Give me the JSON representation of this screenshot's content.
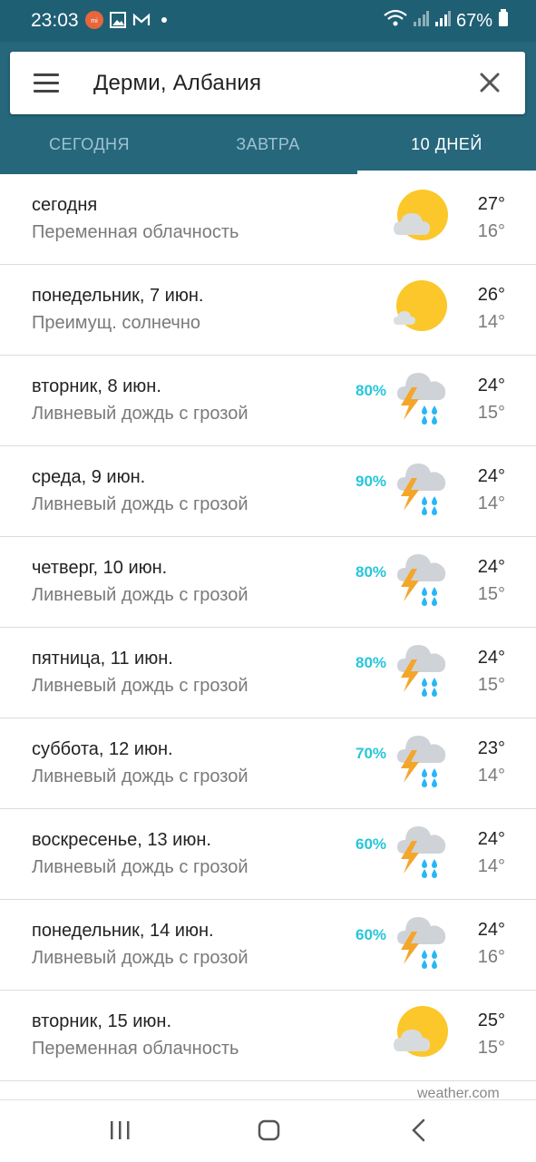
{
  "status_bar": {
    "time": "23:03",
    "battery": "67%",
    "icons": [
      "mi-notification-icon",
      "gallery-icon",
      "gmail-icon",
      "dot-icon",
      "wifi-icon",
      "signal-icon",
      "signal-icon",
      "battery-icon"
    ]
  },
  "search": {
    "location": "Дерми, Албания",
    "menu_icon": "menu-icon",
    "close_icon": "close-icon"
  },
  "tabs": [
    {
      "label": "СЕГОДНЯ",
      "active": false
    },
    {
      "label": "ЗАВТРА",
      "active": false
    },
    {
      "label": "10 ДНЕЙ",
      "active": true
    }
  ],
  "forecast": [
    {
      "day": "сегодня",
      "desc": "Переменная облачность",
      "precip": "",
      "icon": "partly-cloudy-icon",
      "hi": "27°",
      "lo": "16°"
    },
    {
      "day": "понедельник, 7 июн.",
      "desc": "Преимущ. солнечно",
      "precip": "",
      "icon": "mostly-sunny-icon",
      "hi": "26°",
      "lo": "14°"
    },
    {
      "day": "вторник, 8 июн.",
      "desc": "Ливневый дождь с грозой",
      "precip": "80%",
      "icon": "thunderstorm-icon",
      "hi": "24°",
      "lo": "15°"
    },
    {
      "day": "среда, 9 июн.",
      "desc": "Ливневый дождь с грозой",
      "precip": "90%",
      "icon": "thunderstorm-icon",
      "hi": "24°",
      "lo": "14°"
    },
    {
      "day": "четверг, 10 июн.",
      "desc": "Ливневый дождь с грозой",
      "precip": "80%",
      "icon": "thunderstorm-icon",
      "hi": "24°",
      "lo": "15°"
    },
    {
      "day": "пятница, 11 июн.",
      "desc": "Ливневый дождь с грозой",
      "precip": "80%",
      "icon": "thunderstorm-icon",
      "hi": "24°",
      "lo": "15°"
    },
    {
      "day": "суббота, 12 июн.",
      "desc": "Ливневый дождь с грозой",
      "precip": "70%",
      "icon": "thunderstorm-icon",
      "hi": "23°",
      "lo": "14°"
    },
    {
      "day": "воскресенье, 13 июн.",
      "desc": "Ливневый дождь с грозой",
      "precip": "60%",
      "icon": "thunderstorm-icon",
      "hi": "24°",
      "lo": "14°"
    },
    {
      "day": "понедельник, 14 июн.",
      "desc": "Ливневый дождь с грозой",
      "precip": "60%",
      "icon": "thunderstorm-icon",
      "hi": "24°",
      "lo": "16°"
    },
    {
      "day": "вторник, 15 июн.",
      "desc": "Переменная облачность",
      "precip": "",
      "icon": "partly-cloudy-icon",
      "hi": "25°",
      "lo": "15°"
    }
  ],
  "footer": {
    "source": "weather.com"
  },
  "colors": {
    "header": "#26677c",
    "status_bar": "#1f5f74",
    "precip": "#26c6da",
    "sun": "#fbc72a"
  },
  "nav": {
    "icons": [
      "recents-icon",
      "home-icon",
      "back-icon"
    ]
  }
}
